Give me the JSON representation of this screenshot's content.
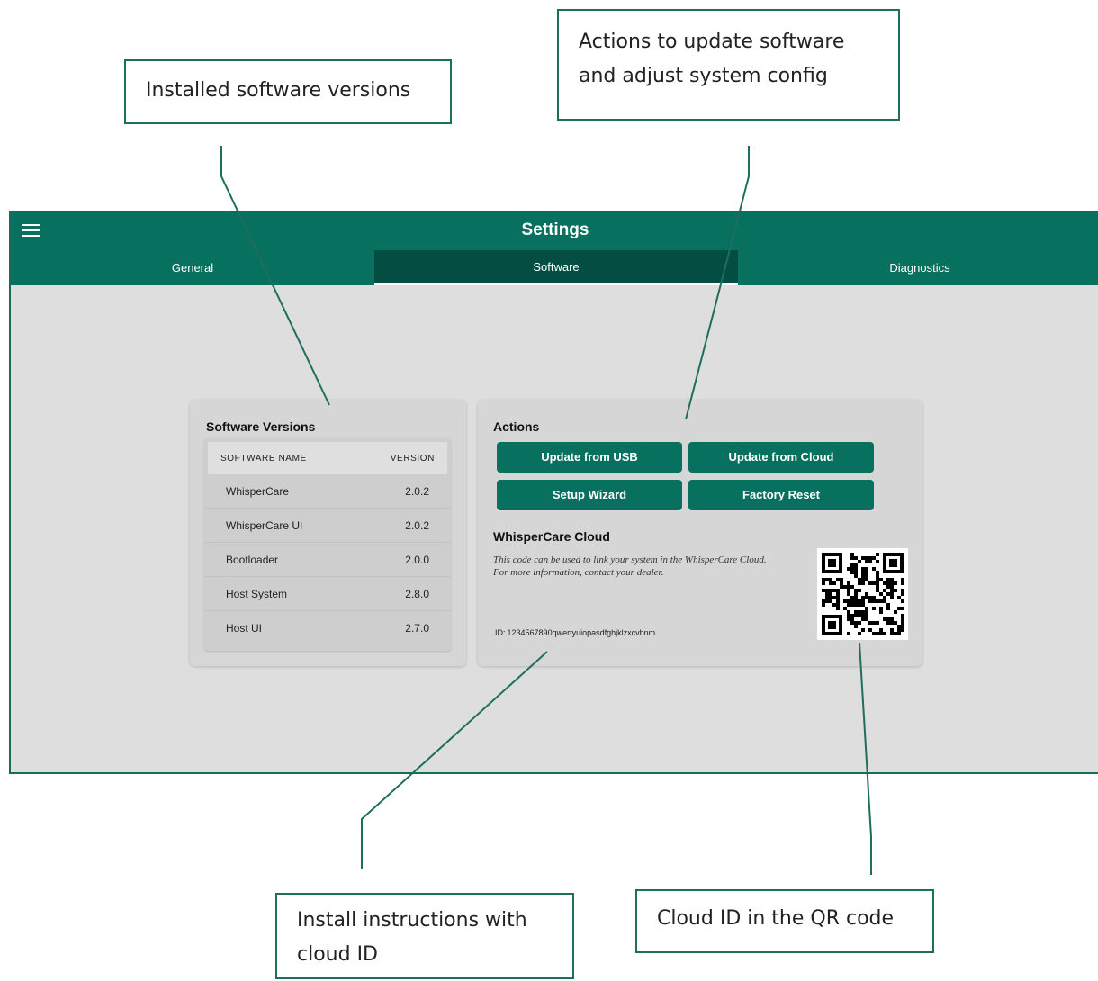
{
  "callouts": {
    "versions": "Installed software versions",
    "actions_line1": "Actions to update software",
    "actions_line2": "and adjust system config",
    "install_line1": "Install instructions with",
    "install_line2": "cloud ID",
    "cloud": "Cloud ID in the QR code"
  },
  "header": {
    "title": "Settings",
    "menu_icon": "hamburger-menu-icon"
  },
  "tabs": [
    {
      "label": "General",
      "active": false
    },
    {
      "label": "Software",
      "active": true
    },
    {
      "label": "Diagnostics",
      "active": false
    }
  ],
  "versions": {
    "title": "Software Versions",
    "col_name": "SOFTWARE NAME",
    "col_version": "VERSION",
    "rows": [
      {
        "name": "WhisperCare",
        "version": "2.0.2"
      },
      {
        "name": "WhisperCare UI",
        "version": "2.0.2"
      },
      {
        "name": "Bootloader",
        "version": "2.0.0"
      },
      {
        "name": "Host System",
        "version": "2.8.0"
      },
      {
        "name": "Host UI",
        "version": "2.7.0"
      }
    ]
  },
  "actions": {
    "title": "Actions",
    "update_usb": "Update from USB",
    "update_cloud": "Update from Cloud",
    "setup_wizard": "Setup Wizard",
    "factory_reset": "Factory Reset"
  },
  "cloud": {
    "title": "WhisperCare Cloud",
    "desc_line1": "This code can be used to link your system in the WhisperCare Cloud.",
    "desc_line2": "For more information, contact your dealer.",
    "id_label": "ID:",
    "id_value": "1234567890qwertyuiopasdfghjklzxcvbnm"
  },
  "colors": {
    "accent": "#08705e",
    "active_tab": "#044d42",
    "background": "#dedede",
    "card": "#d6d6d6",
    "callout_border": "#1e6e5e"
  }
}
